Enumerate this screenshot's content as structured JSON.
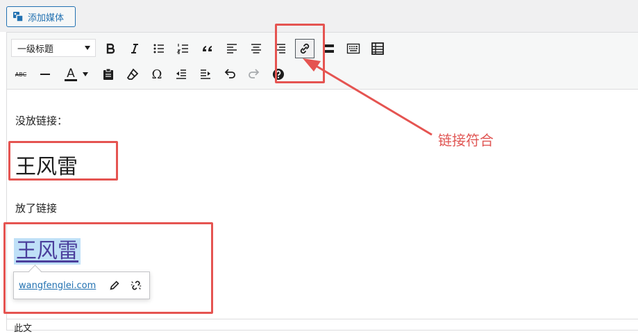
{
  "top": {
    "add_media_label": "添加媒体"
  },
  "toolbar": {
    "format_select": "一级标题",
    "tooltip_none": "",
    "text_color_letter": "A",
    "strike_label": "ABC",
    "omega": "Ω"
  },
  "content": {
    "para1": "没放链接：",
    "heading_plain": "王风雷",
    "para2": "放了链接",
    "heading_link": "王风雷",
    "link_url": "wangfenglei.com",
    "bottom_text": "此文"
  },
  "annotation": {
    "label": "链接符合",
    "color": "#e05654"
  },
  "colors": {
    "accent": "#2271b1",
    "highlight": "#bfe0f7",
    "annotation_box": "#e55451"
  }
}
